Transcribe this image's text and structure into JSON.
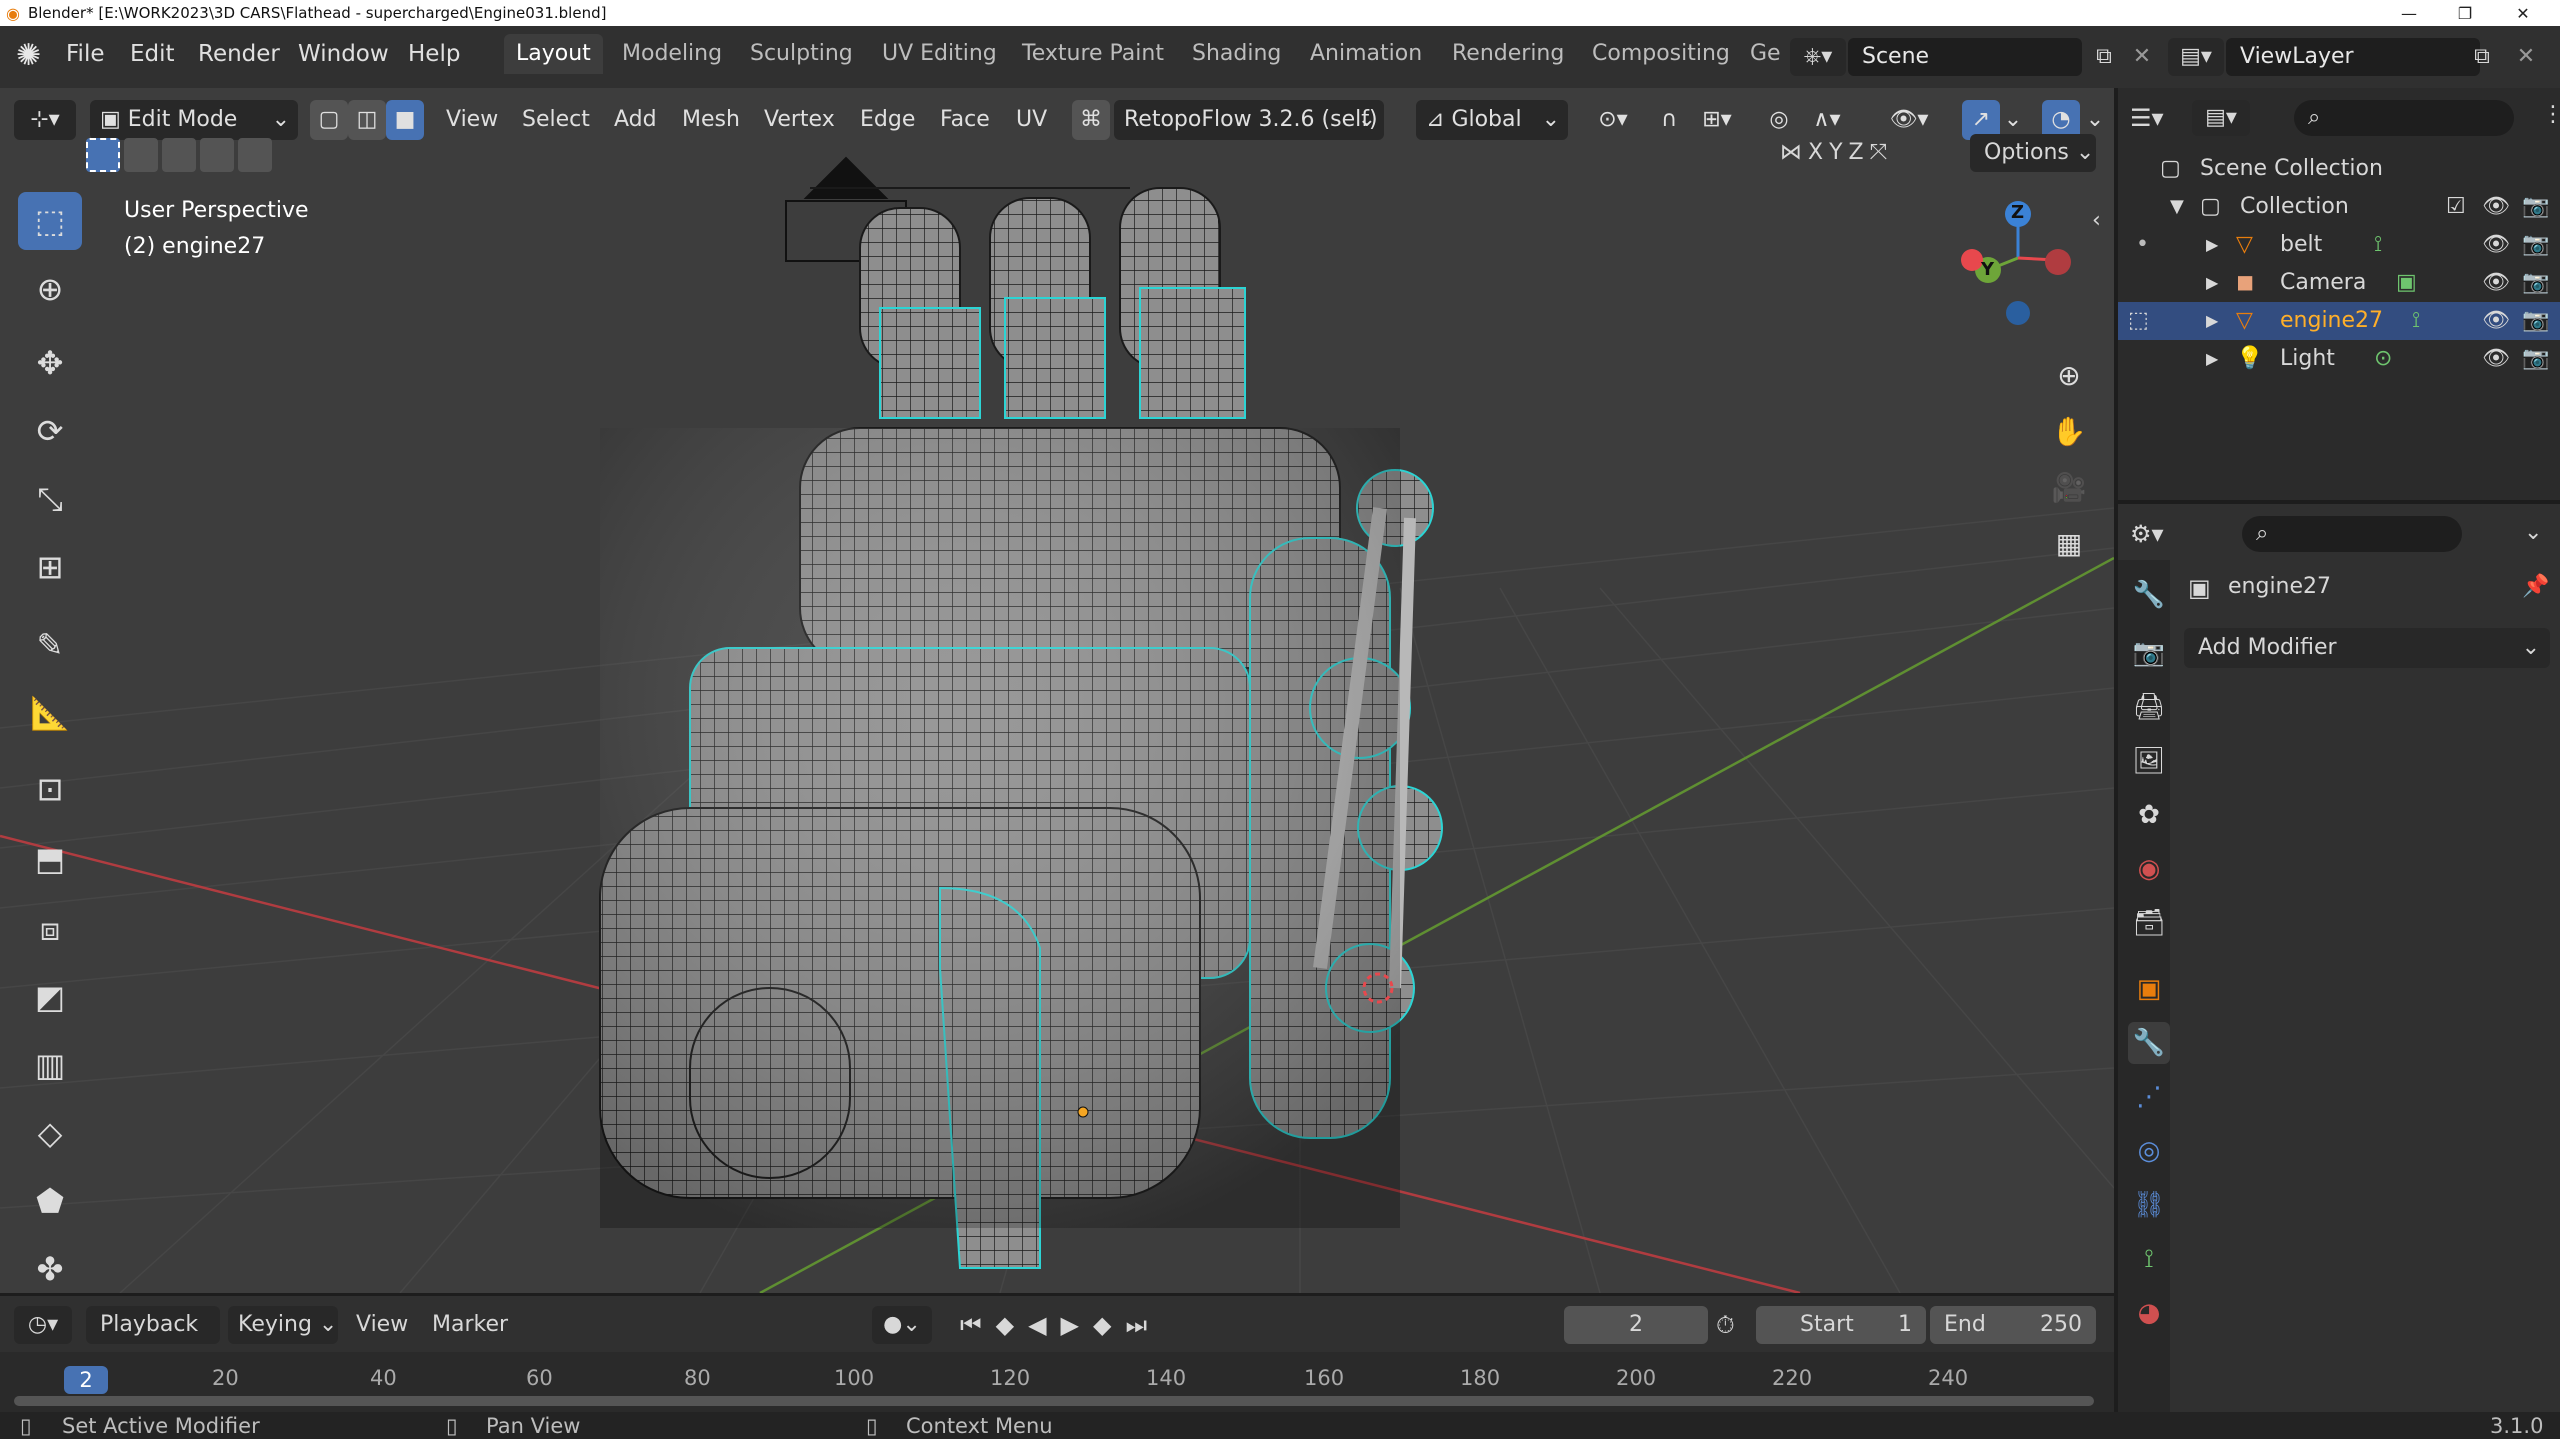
{
  "window": {
    "title": "Blender* [E:\\WORK2023\\3D CARS\\Flathead - supercharged\\Engine031.blend]",
    "min": "—",
    "max": "❐",
    "close": "✕"
  },
  "menu": [
    "File",
    "Edit",
    "Render",
    "Window",
    "Help"
  ],
  "workspaces": [
    "Layout",
    "Modeling",
    "Sculpting",
    "UV Editing",
    "Texture Paint",
    "Shading",
    "Animation",
    "Rendering",
    "Compositing",
    "Ge"
  ],
  "scene": {
    "name": "Scene",
    "view_layer": "ViewLayer"
  },
  "viewport_header": {
    "mode": "Edit Mode",
    "menus": [
      "View",
      "Select",
      "Add",
      "Mesh",
      "Vertex",
      "Edge",
      "Face",
      "UV"
    ],
    "addon": "RetopoFlow 3.2.6 (self)",
    "transform": "Global",
    "axes": [
      "X",
      "Y",
      "Z"
    ],
    "options": "Options"
  },
  "viewport": {
    "perspective": "User Perspective",
    "object_label": "(2) engine27",
    "gizmo": {
      "z": "Z",
      "y": "Y"
    }
  },
  "timeline": {
    "menus": [
      "Playback",
      "Keying",
      "View",
      "Marker"
    ],
    "current_frame": "2",
    "start_label": "Start",
    "start_value": "1",
    "end_label": "End",
    "end_value": "250",
    "ticks": [
      "20",
      "40",
      "60",
      "80",
      "100",
      "120",
      "140",
      "160",
      "180",
      "200",
      "220",
      "240"
    ],
    "frame_indicator": "2"
  },
  "outliner": {
    "root": "Scene Collection",
    "collection": "Collection",
    "items": [
      {
        "name": "belt",
        "icon": "mesh-icon",
        "color": "#e87d0d"
      },
      {
        "name": "Camera",
        "icon": "camera-icon",
        "color": "#e8a27a"
      },
      {
        "name": "engine27",
        "icon": "mesh-icon",
        "color": "#e87d0d",
        "selected": true
      },
      {
        "name": "Light",
        "icon": "light-icon",
        "color": "#e8a27a"
      }
    ]
  },
  "properties": {
    "object_name": "engine27",
    "add_modifier": "Add Modifier"
  },
  "status": {
    "left": "Set Active Modifier",
    "middle": "Pan View",
    "right": "Context Menu",
    "version": "3.1.0"
  },
  "colors": {
    "accent": "#4772b3",
    "x_axis": "#e8484d",
    "y_axis": "#6ea539",
    "z_axis": "#3b82d6",
    "wire": "#2cd4d4"
  }
}
